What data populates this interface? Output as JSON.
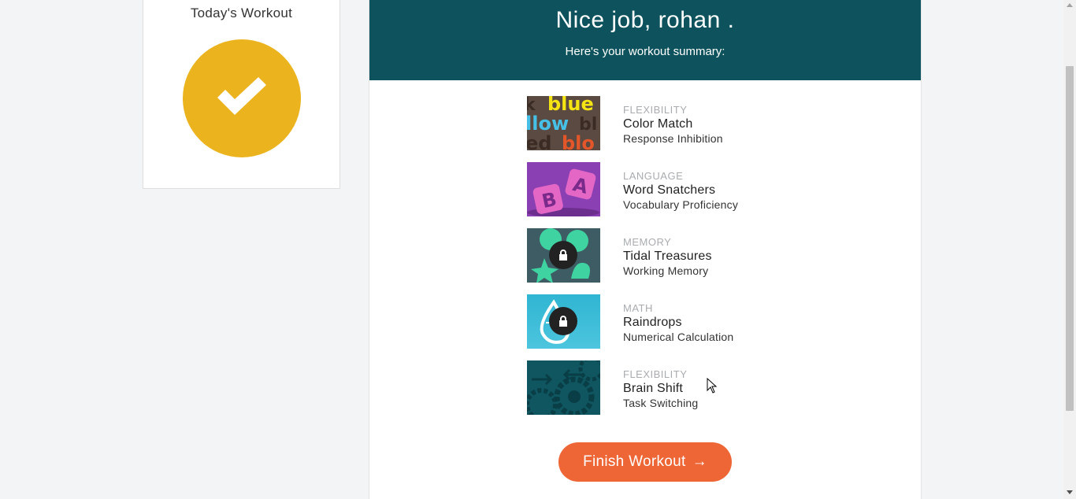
{
  "sidebar": {
    "title": "Today's Workout",
    "status_icon": "checkmark-icon",
    "accent_color": "#ebb31d"
  },
  "header": {
    "title": "Nice job, rohan .",
    "subtitle": "Here's your workout summary:",
    "background": "#0d525c"
  },
  "games": [
    {
      "category": "FLEXIBILITY",
      "name": "Color Match",
      "skill": "Response Inhibition",
      "locked": false
    },
    {
      "category": "LANGUAGE",
      "name": "Word Snatchers",
      "skill": "Vocabulary Proficiency",
      "locked": false
    },
    {
      "category": "MEMORY",
      "name": "Tidal Treasures",
      "skill": "Working Memory",
      "locked": true
    },
    {
      "category": "MATH",
      "name": "Raindrops",
      "skill": "Numerical Calculation",
      "locked": true
    },
    {
      "category": "FLEXIBILITY",
      "name": "Brain Shift",
      "skill": "Task Switching",
      "locked": false
    }
  ],
  "thumb_text": {
    "color_match_words": [
      "k",
      "blue",
      "llow",
      "bl",
      "ed",
      "blo"
    ],
    "word_snatchers_tiles": [
      "B",
      "A"
    ]
  },
  "finish_button": {
    "label": "Finish Workout",
    "arrow": "→",
    "color": "#ee6536"
  }
}
